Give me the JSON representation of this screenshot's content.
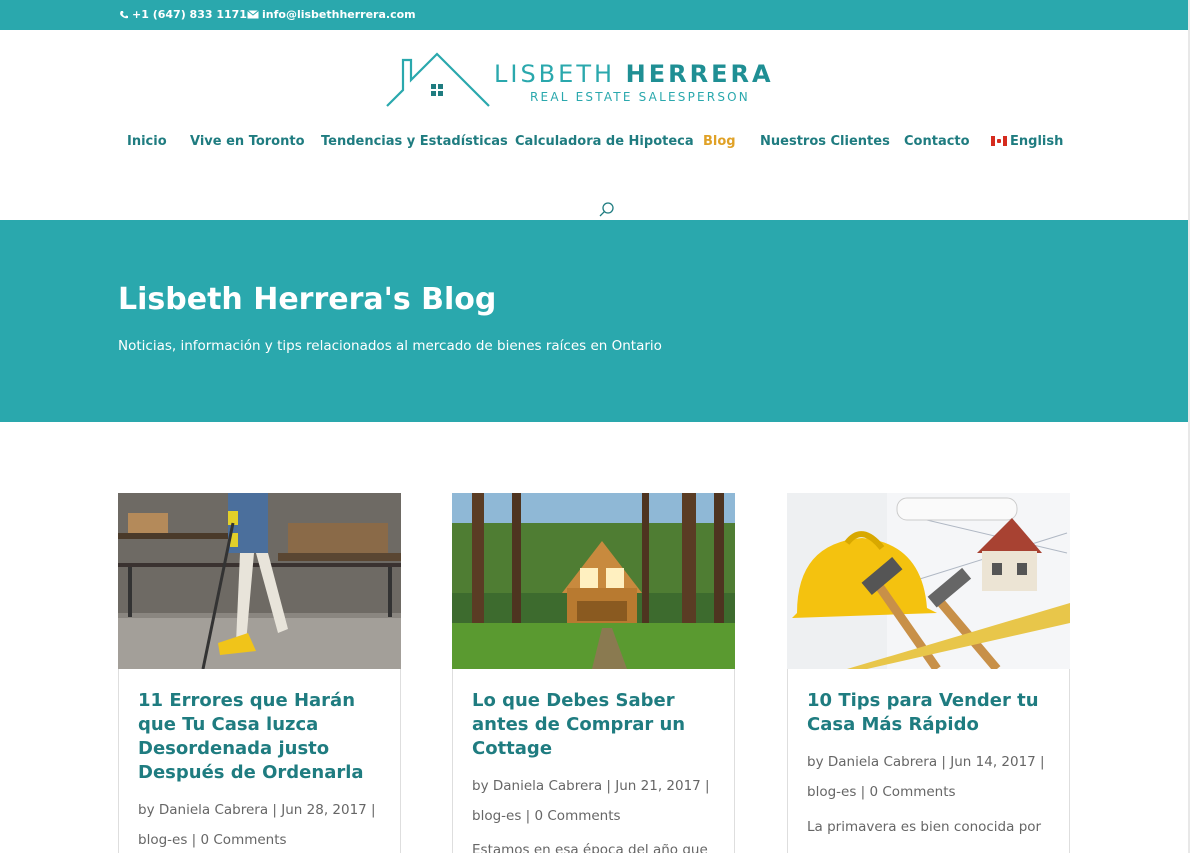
{
  "topbar": {
    "phone": "+1 (647) 833 1171",
    "email": "info@lisbethherrera.com"
  },
  "logo": {
    "first_name": "LISBETH",
    "last_name": "HERRERA",
    "subtitle": "REAL ESTATE SALESPERSON"
  },
  "nav": {
    "items": [
      {
        "label": "Inicio"
      },
      {
        "label": "Vive en Toronto"
      },
      {
        "label": "Tendencias y Estadísticas"
      },
      {
        "label": "Calculadora de Hipoteca"
      },
      {
        "label": "Blog"
      },
      {
        "label": "Nuestros Clientes"
      },
      {
        "label": "Contacto"
      },
      {
        "label": "English"
      }
    ],
    "active": "Blog"
  },
  "hero": {
    "title": "Lisbeth Herrera's Blog",
    "subtitle": "Noticias, información y tips relacionados al mercado de bienes raíces en Ontario"
  },
  "posts": [
    {
      "title": "11 Errores que Harán que Tu Casa luzca Desordenada justo Después de Ordenarla",
      "author": "Daniela Cabrera",
      "date": "Jun 28, 2017",
      "category": "blog-es",
      "comments": "0 Comments",
      "excerpt": ""
    },
    {
      "title": "Lo que Debes Saber antes de Comprar un Cottage",
      "author": "Daniela Cabrera",
      "date": "Jun 21, 2017",
      "category": "blog-es",
      "comments": "0 Comments",
      "excerpt": "Estamos en esa época del año que"
    },
    {
      "title": "10 Tips para Vender tu Casa Más Rápido",
      "author": "Daniela Cabrera",
      "date": "Jun 14, 2017",
      "category": "blog-es",
      "comments": "0 Comments",
      "excerpt": "La primavera es bien conocida por"
    }
  ],
  "meta_by": "by",
  "colors": {
    "brand": "#2aa8ad",
    "nav_text": "#1f7c80",
    "active_nav": "#e0a126"
  }
}
